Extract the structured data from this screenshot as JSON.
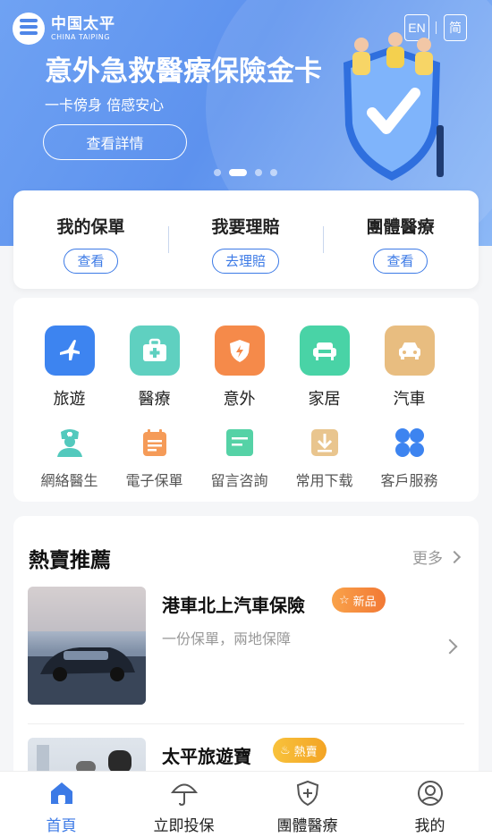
{
  "brand": {
    "name_cn": "中国太平",
    "name_en": "CHINA TAIPING"
  },
  "lang": {
    "en": "EN",
    "zh": "简"
  },
  "banner": {
    "title": "意外急救醫療保險金卡",
    "subtitle": "一卡傍身 倍感安心",
    "button": "查看詳情",
    "dots_total": 4,
    "dots_active_index": 1
  },
  "quick_actions": [
    {
      "title": "我的保單",
      "button": "查看"
    },
    {
      "title": "我要理賠",
      "button": "去理賠"
    },
    {
      "title": "團體醫療",
      "button": "查看"
    }
  ],
  "services_main": [
    {
      "label": "旅遊",
      "icon": "airplane-icon",
      "color": "#3d84f0"
    },
    {
      "label": "醫療",
      "icon": "medical-kit-icon",
      "color": "#5fd0c0"
    },
    {
      "label": "意外",
      "icon": "shield-bolt-icon",
      "color": "#f58a4a"
    },
    {
      "label": "家居",
      "icon": "sofa-icon",
      "color": "#49d3a6"
    },
    {
      "label": "汽車",
      "icon": "car-icon",
      "color": "#e8bd80"
    }
  ],
  "services_secondary": [
    {
      "label": "網絡醫生",
      "icon": "doctor-icon",
      "color": "#53c9bd"
    },
    {
      "label": "電子保單",
      "icon": "calendar-icon",
      "color": "#f59b58"
    },
    {
      "label": "留言咨詢",
      "icon": "message-icon",
      "color": "#55d2a6"
    },
    {
      "label": "常用下载",
      "icon": "download-icon",
      "color": "#e9c58e"
    },
    {
      "label": "客戶服務",
      "icon": "service-grid-icon",
      "color": "#3d84f0"
    }
  ],
  "hot": {
    "title": "熱賣推薦",
    "more": "更多",
    "products": [
      {
        "name": "港車北上汽車保險",
        "badge": "新品",
        "desc": "一份保單，兩地保障"
      },
      {
        "name": "太平旅遊寶",
        "badge": "熱賣",
        "desc": ""
      }
    ]
  },
  "nav": [
    {
      "label": "首頁",
      "icon": "home-icon",
      "active": true
    },
    {
      "label": "立即投保",
      "icon": "umbrella-icon",
      "active": false
    },
    {
      "label": "團體醫療",
      "icon": "shield-plus-icon",
      "active": false
    },
    {
      "label": "我的",
      "icon": "user-icon",
      "active": false
    }
  ],
  "colors": {
    "primary": "#3c7ae6",
    "banner": "#6fa2f3",
    "badge_new": "#f27935",
    "badge_hot": "#f3a425"
  }
}
